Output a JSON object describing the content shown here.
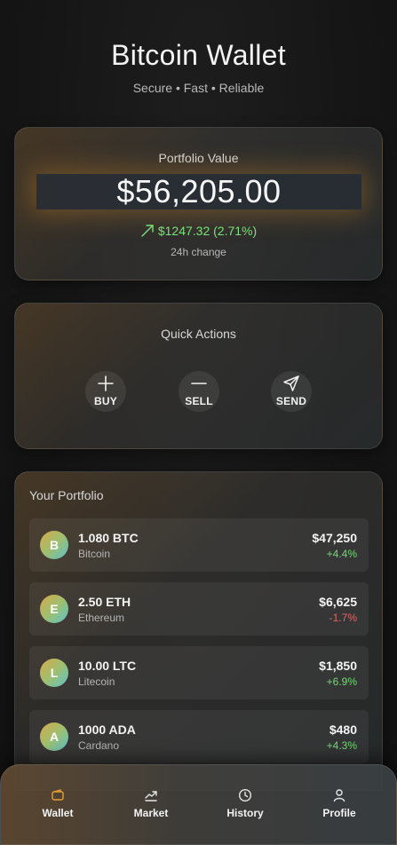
{
  "header": {
    "title": "Bitcoin Wallet",
    "subtitle": "Secure • Fast • Reliable"
  },
  "portfolio_value": {
    "label": "Portfolio Value",
    "amount": "$56,205.00",
    "change": "$1247.32 (2.71%)",
    "change_label": "24h change"
  },
  "quick_actions": {
    "title": "Quick Actions",
    "buy_label": "BUY",
    "sell_label": "SELL",
    "send_label": "SEND"
  },
  "your_portfolio": {
    "title": "Your Portfolio",
    "assets": [
      {
        "letter": "B",
        "amount": "1.080 BTC",
        "name": "Bitcoin",
        "value": "$47,250",
        "change": "+4.4%",
        "direction": "pos"
      },
      {
        "letter": "E",
        "amount": "2.50 ETH",
        "name": "Ethereum",
        "value": "$6,625",
        "change": "-1.7%",
        "direction": "neg"
      },
      {
        "letter": "L",
        "amount": "10.00 LTC",
        "name": "Litecoin",
        "value": "$1,850",
        "change": "+6.9%",
        "direction": "pos"
      },
      {
        "letter": "A",
        "amount": "1000 ADA",
        "name": "Cardano",
        "value": "$480",
        "change": "+4.3%",
        "direction": "pos"
      }
    ]
  },
  "nav": {
    "wallet": "Wallet",
    "market": "Market",
    "history": "History",
    "profile": "Profile"
  },
  "colors": {
    "accent_orange": "#d68c28",
    "positive": "#72d972",
    "negative": "#e06666"
  },
  "icons": {
    "change": "trend-up-icon",
    "buy": "plus-icon",
    "sell": "minus-icon",
    "send": "send-icon",
    "wallet": "wallet-icon",
    "market": "chart-icon",
    "history": "clock-icon",
    "profile": "user-icon"
  }
}
